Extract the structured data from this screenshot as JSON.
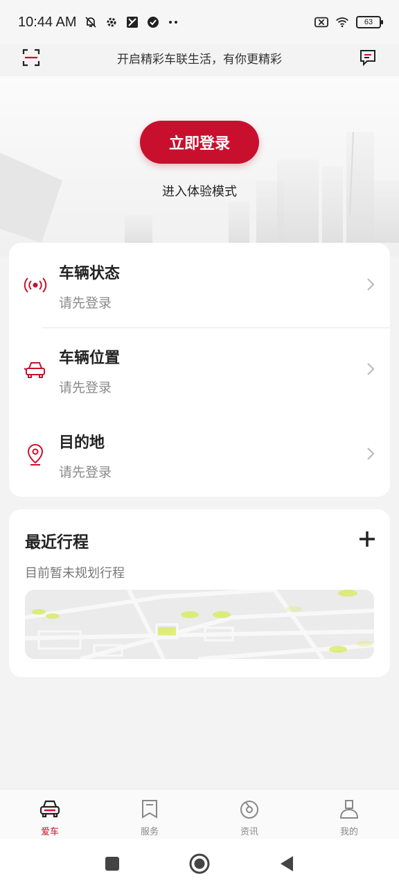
{
  "status_bar": {
    "time": "10:44 AM",
    "battery": "63",
    "icons": [
      "mute-icon",
      "settings-icon",
      "app-icon",
      "check-icon",
      "more-icon",
      "sim-off-icon",
      "wifi-icon",
      "battery-icon"
    ]
  },
  "header": {
    "slogan": "开启精彩车联生活，有你更精彩",
    "left_icon": "scan-icon",
    "right_icon": "message-icon"
  },
  "hero": {
    "login_label": "立即登录",
    "trial_label": "进入体验模式"
  },
  "vehicle_card": {
    "items": [
      {
        "title": "车辆状态",
        "subtitle": "请先登录",
        "icon": "signal-icon"
      },
      {
        "title": "车辆位置",
        "subtitle": "请先登录",
        "icon": "car-icon"
      },
      {
        "title": "目的地",
        "subtitle": "请先登录",
        "icon": "location-pin-icon"
      }
    ]
  },
  "trip_card": {
    "title": "最近行程",
    "subtitle": "目前暂未规划行程",
    "add_icon": "plus-icon"
  },
  "tab_bar": {
    "tabs": [
      {
        "label": "爱车",
        "icon": "car-front-icon",
        "active": true
      },
      {
        "label": "服务",
        "icon": "bookmark-icon",
        "active": false
      },
      {
        "label": "资讯",
        "icon": "disc-icon",
        "active": false
      },
      {
        "label": "我的",
        "icon": "user-icon",
        "active": false
      }
    ]
  },
  "colors": {
    "accent": "#c8102e",
    "background": "#f3f3f3",
    "card": "#ffffff",
    "subtext": "#8a8a8a"
  }
}
